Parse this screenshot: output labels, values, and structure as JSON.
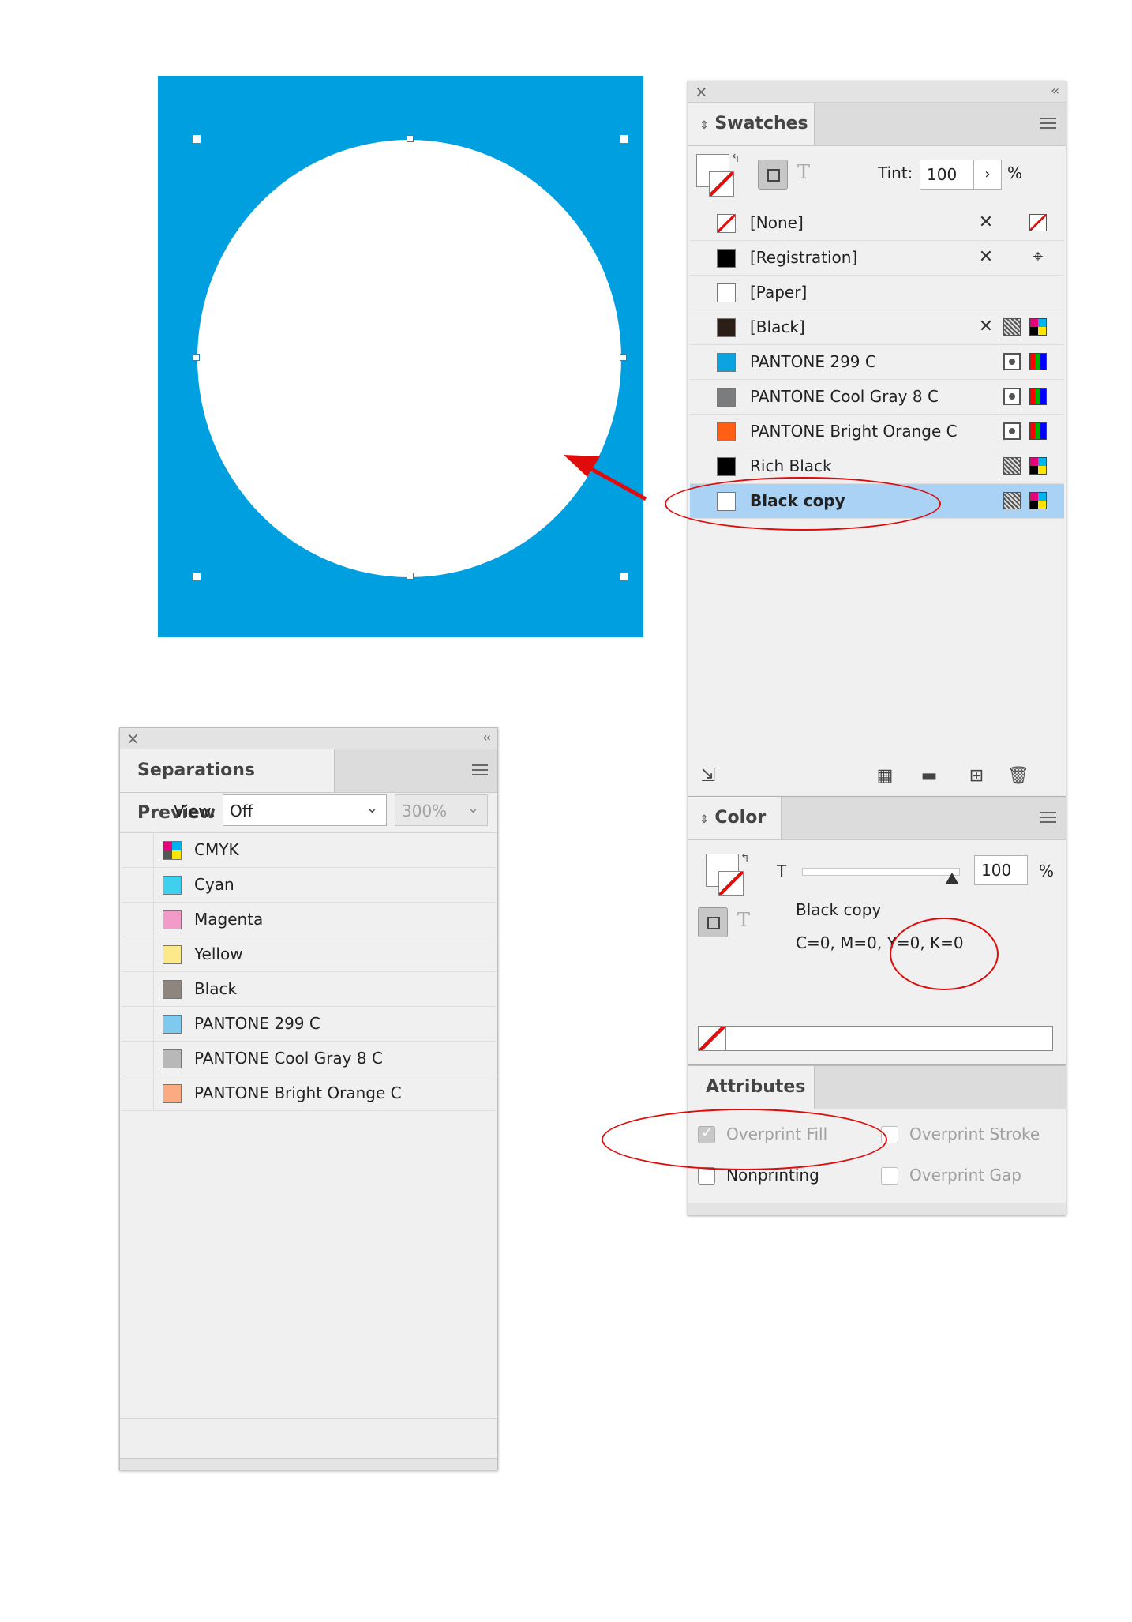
{
  "swatches_panel": {
    "title": "Swatches",
    "tint_label": "Tint:",
    "tint_value": "100",
    "tint_unit": "%",
    "text_mode_glyph": "T",
    "swatches": [
      {
        "name": "[None]",
        "color": "none",
        "mode_icon": "",
        "type_icon": "none-icon"
      },
      {
        "name": "[Registration]",
        "color": "#000000",
        "mode_icon": "",
        "type_icon": "registration-icon"
      },
      {
        "name": "[Paper]",
        "color": "#ffffff",
        "mode_icon": "",
        "type_icon": ""
      },
      {
        "name": "[Black]",
        "color": "#2b1f17",
        "mode_icon": "process",
        "type_icon": "cmyk"
      },
      {
        "name": "PANTONE 299 C",
        "color": "#0ba3e0",
        "mode_icon": "spot",
        "type_icon": "spot"
      },
      {
        "name": "PANTONE Cool Gray 8 C",
        "color": "#7b7c7e",
        "mode_icon": "spot",
        "type_icon": "spot"
      },
      {
        "name": "PANTONE Bright Orange C",
        "color": "#ff5e14",
        "mode_icon": "spot",
        "type_icon": "spot"
      },
      {
        "name": "Rich Black",
        "color": "#000000",
        "mode_icon": "process",
        "type_icon": "cmyk"
      },
      {
        "name": "Black copy",
        "color": "#ffffff",
        "mode_icon": "process",
        "type_icon": "cmyk",
        "selected": true
      }
    ]
  },
  "color_panel": {
    "title": "Color",
    "tint_label": "T",
    "tint_value": "100",
    "tint_unit": "%",
    "swatch_name": "Black copy",
    "values": "C=0, M=0, Y=0, K=0",
    "text_mode_glyph": "T"
  },
  "attributes_panel": {
    "title": "Attributes",
    "overprint_fill": "Overprint Fill",
    "overprint_stroke": "Overprint Stroke",
    "nonprinting": "Nonprinting",
    "overprint_gap": "Overprint Gap"
  },
  "separations_panel": {
    "title": "Separations Preview",
    "view_label": "View:",
    "view_value": "Off",
    "zoom_value": "300%",
    "inks": [
      {
        "name": "CMYK",
        "color": "cmyk"
      },
      {
        "name": "Cyan",
        "color": "#3fd0f0"
      },
      {
        "name": "Magenta",
        "color": "#f29ac8"
      },
      {
        "name": "Yellow",
        "color": "#fbe98a"
      },
      {
        "name": "Black",
        "color": "#8f857f"
      },
      {
        "name": "PANTONE 299 C",
        "color": "#7ecaee"
      },
      {
        "name": "PANTONE Cool Gray 8 C",
        "color": "#b8b8b8"
      },
      {
        "name": "PANTONE Bright Orange C",
        "color": "#fcaa82"
      }
    ]
  },
  "accent_colors": {
    "artboard_fill": "#00a0e0",
    "selected_row": "#a9d2f5",
    "annotation_red": "#e00c0c"
  }
}
